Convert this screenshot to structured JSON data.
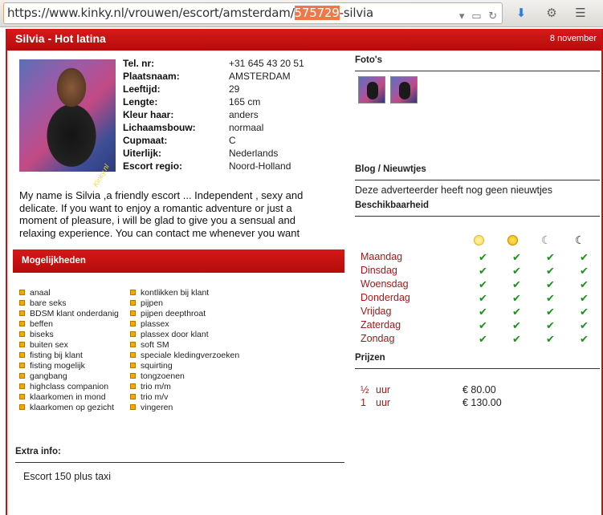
{
  "browser": {
    "url_prefix": "https://www.kinky.nl/vrouwen/escort/amsterdam/",
    "url_highlight": "575729",
    "url_suffix": "-silvia"
  },
  "header": {
    "title": "Silvia - Hot latina",
    "date": "8 november"
  },
  "photo": {
    "watermark": "Kinky.nl"
  },
  "profile": [
    {
      "label": "Tel. nr:",
      "value": "+31 645 43 20 51"
    },
    {
      "label": "Plaatsnaam:",
      "value": "AMSTERDAM"
    },
    {
      "label": "Leeftijd:",
      "value": "29"
    },
    {
      "label": "Lengte:",
      "value": "165 cm"
    },
    {
      "label": "Kleur haar:",
      "value": "anders"
    },
    {
      "label": "Lichaamsbouw:",
      "value": "normaal"
    },
    {
      "label": "Cupmaat:",
      "value": "C"
    },
    {
      "label": "Uiterlijk:",
      "value": "Nederlands"
    },
    {
      "label": "Escort regio:",
      "value": "Noord-Holland"
    }
  ],
  "description": "My name is Silvia ,a friendly escort ... Independent , sexy and delicate. If you want to enjoy a romantic adventure or just a moment of pleasure, i will be glad to give you a sensual and relaxing experience. You can contact me whenever you want",
  "mogelijkheden": {
    "heading": "Mogelijkheden",
    "col1": [
      "anaal",
      "bare seks",
      "BDSM klant onderdanig",
      "beffen",
      "biseks",
      "buiten sex",
      "fisting bij klant",
      "fisting mogelijk",
      "gangbang",
      "highclass companion",
      "klaarkomen in mond",
      "klaarkomen op gezicht"
    ],
    "col2": [
      "kontlikken bij klant",
      "pijpen",
      "pijpen deepthroat",
      "plassex",
      "plassex door klant",
      "soft SM",
      "speciale kledingverzoeken",
      "squirting",
      "tongzoenen",
      "trio m/m",
      "trio m/v",
      "vingeren"
    ]
  },
  "extra": {
    "heading": "Extra info:",
    "text": "Escort 150 plus taxi"
  },
  "fotos": {
    "heading": "Foto's"
  },
  "blog": {
    "heading": "Blog / Nieuwtjes",
    "text": "Deze adverteerder heeft nog geen nieuwtjes"
  },
  "availability": {
    "heading": "Beschikbaarheid",
    "check": "✔",
    "days": [
      "Maandag",
      "Dinsdag",
      "Woensdag",
      "Donderdag",
      "Vrijdag",
      "Zaterdag",
      "Zondag"
    ]
  },
  "prijzen": {
    "heading": "Prijzen",
    "rows": [
      {
        "qty": "½",
        "unit": "uur",
        "price": "€ 80.00"
      },
      {
        "qty": "1",
        "unit": "uur",
        "price": "€ 130.00"
      }
    ]
  },
  "colors": {
    "accent_red": "#c81010",
    "day_red": "#a3191a",
    "check_green": "#1d8f1d"
  }
}
